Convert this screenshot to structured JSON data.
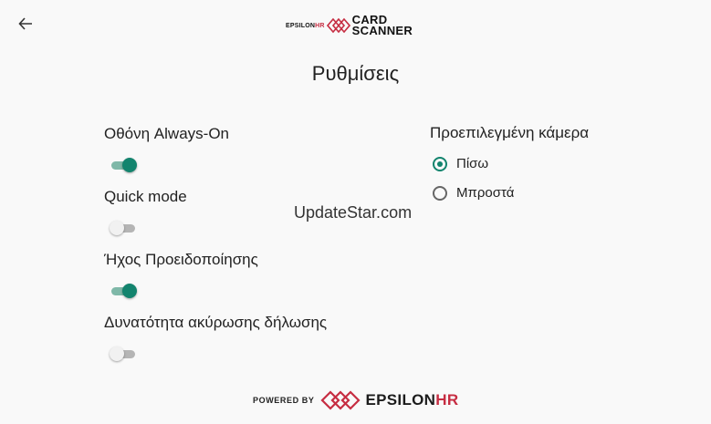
{
  "header": {
    "back_icon": "arrow-left-icon",
    "logo": {
      "brand_small": "EPSILON",
      "brand_small_hr": "HR",
      "product_line1": "CARD",
      "product_line2": "SCANNER",
      "accent_color": "#c62d42"
    }
  },
  "page": {
    "title": "Ρυθμίσεις"
  },
  "settings": [
    {
      "label": "Οθόνη Always-On",
      "enabled": true
    },
    {
      "label": "Quick mode",
      "enabled": false
    },
    {
      "label": "Ήχος Προειδοποίησης",
      "enabled": true
    },
    {
      "label": "Δυνατότητα ακύρωσης δήλωσης",
      "enabled": false
    }
  ],
  "camera": {
    "title": "Προεπιλεγμένη κάμερα",
    "options": [
      {
        "label": "Πίσω",
        "selected": true
      },
      {
        "label": "Μπροστά",
        "selected": false
      }
    ]
  },
  "watermark": "UpdateStar.com",
  "footer": {
    "powered_by": "POWERED BY",
    "brand": "EPSILON",
    "brand_hr": "HR"
  },
  "colors": {
    "toggle_on": "#13846e",
    "toggle_on_track": "#7fb8a8",
    "toggle_off_track": "#b5b5b5"
  }
}
